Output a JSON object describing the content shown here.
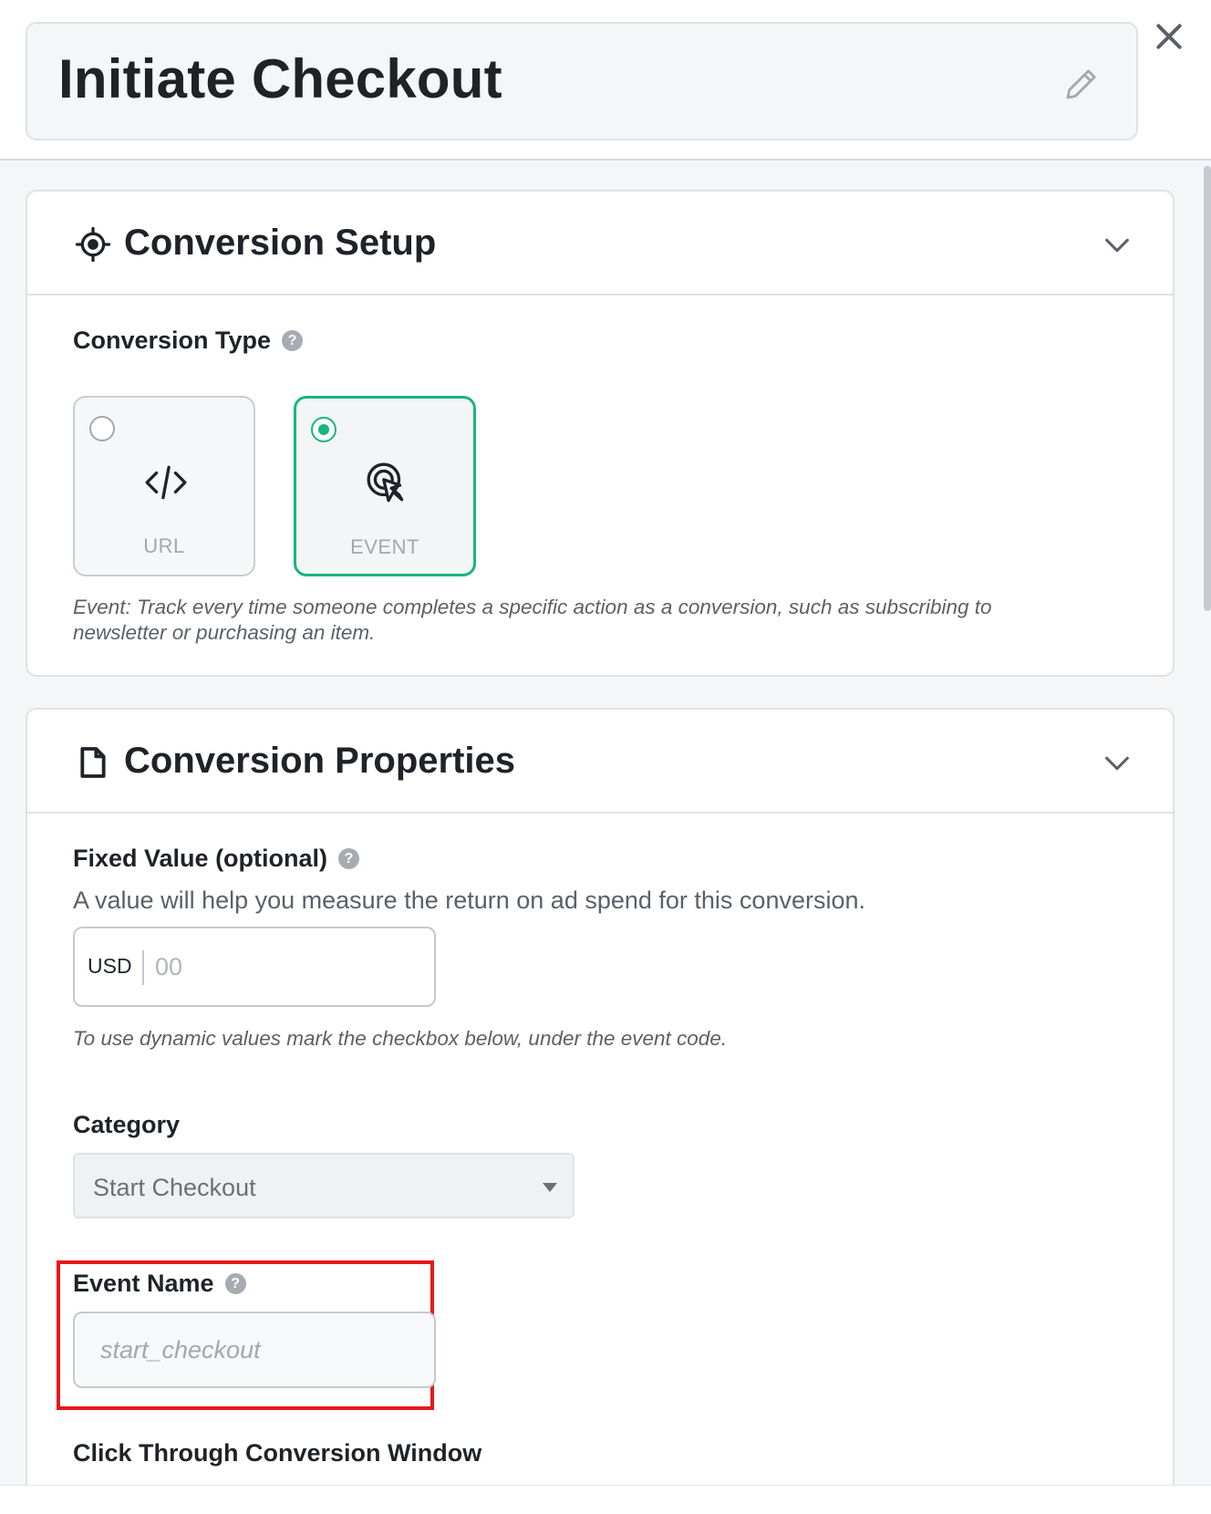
{
  "header": {
    "title": "Initiate Checkout",
    "edit_icon": "pencil-icon",
    "close_icon": "close-icon"
  },
  "conversion_setup": {
    "title": "Conversion Setup",
    "icon": "crosshair-icon",
    "type_label": "Conversion Type",
    "options": [
      {
        "label": "URL",
        "icon": "code-icon",
        "selected": false
      },
      {
        "label": "EVENT",
        "icon": "tap-cursor-icon",
        "selected": true
      }
    ],
    "description": "Event: Track every time someone completes a specific action as a conversion, such as subscribing to newsletter or purchasing an item."
  },
  "conversion_properties": {
    "title": "Conversion Properties",
    "icon": "document-icon",
    "fixed_value": {
      "label": "Fixed Value (optional)",
      "hint": "A value will help you measure the return on ad spend for this conversion.",
      "currency": "USD",
      "placeholder": "00",
      "dynamic_hint": "To use dynamic values mark the checkbox below, under the event code."
    },
    "category": {
      "label": "Category",
      "selected": "Start Checkout"
    },
    "event_name": {
      "label": "Event Name",
      "placeholder": "start_checkout"
    },
    "click_through_label": "Click Through Conversion Window"
  },
  "colors": {
    "accent": "#17b67d",
    "highlight": "#e61919"
  }
}
